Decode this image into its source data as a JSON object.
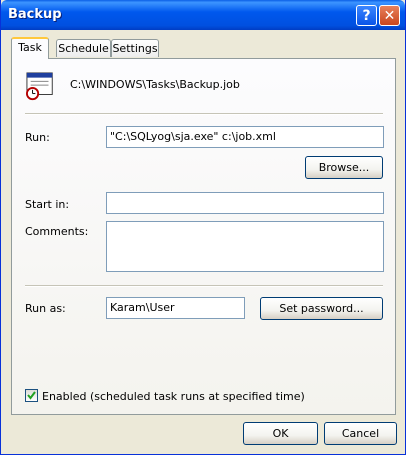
{
  "window": {
    "title": "Backup"
  },
  "titlebar": {
    "help_glyph": "?",
    "close_glyph": "✕"
  },
  "tabs": [
    {
      "label": "Task",
      "active": true
    },
    {
      "label": "Schedule",
      "active": false
    },
    {
      "label": "Settings",
      "active": false
    }
  ],
  "task": {
    "icon": "scheduled-task-icon",
    "path": "C:\\WINDOWS\\Tasks\\Backup.job",
    "run_label": "Run:",
    "run_value": "\"C:\\SQLyog\\sja.exe\" c:\\job.xml",
    "browse_label": "Browse...",
    "start_in_label": "Start in:",
    "start_in_value": "",
    "comments_label": "Comments:",
    "comments_value": "",
    "run_as_label": "Run as:",
    "run_as_value": "Karam\\User",
    "set_password_label": "Set password...",
    "enabled_label": "Enabled (scheduled task runs at specified time)",
    "enabled_checked": true
  },
  "footer": {
    "ok_label": "OK",
    "cancel_label": "Cancel"
  }
}
